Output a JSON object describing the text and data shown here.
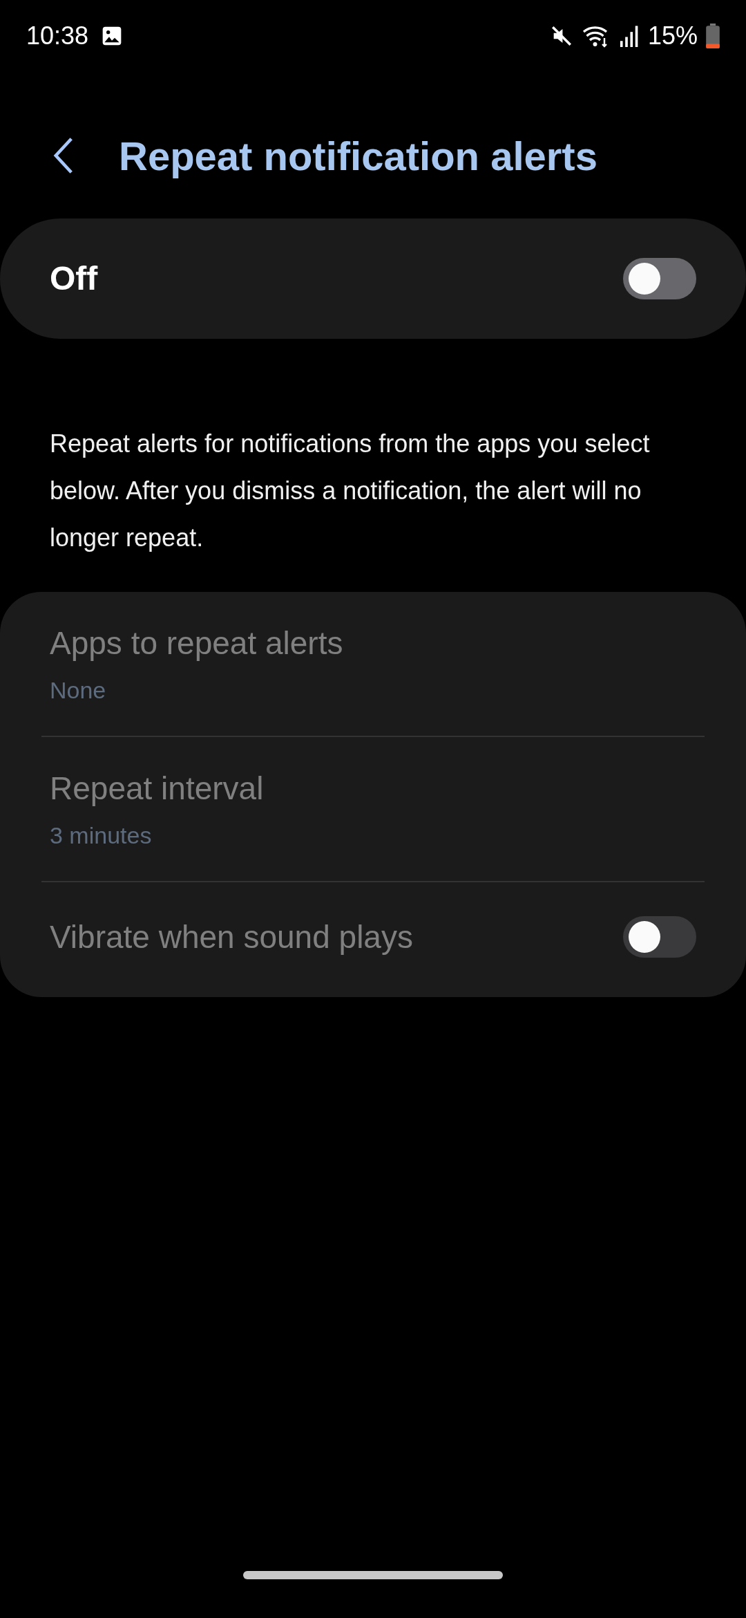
{
  "status_bar": {
    "time": "10:38",
    "battery": "15%"
  },
  "header": {
    "title": "Repeat notification alerts"
  },
  "master_switch": {
    "label": "Off",
    "on": false
  },
  "description": "Repeat alerts for notifications from the apps you select below. After you dismiss a notification, the alert will no longer repeat.",
  "settings": [
    {
      "kind": "value",
      "title": "Apps to repeat alerts",
      "value": "None",
      "disabled": true
    },
    {
      "kind": "value",
      "title": "Repeat interval",
      "value": "3 minutes",
      "disabled": true
    },
    {
      "kind": "switch",
      "title": "Vibrate when sound plays",
      "on": false,
      "disabled": true
    }
  ]
}
